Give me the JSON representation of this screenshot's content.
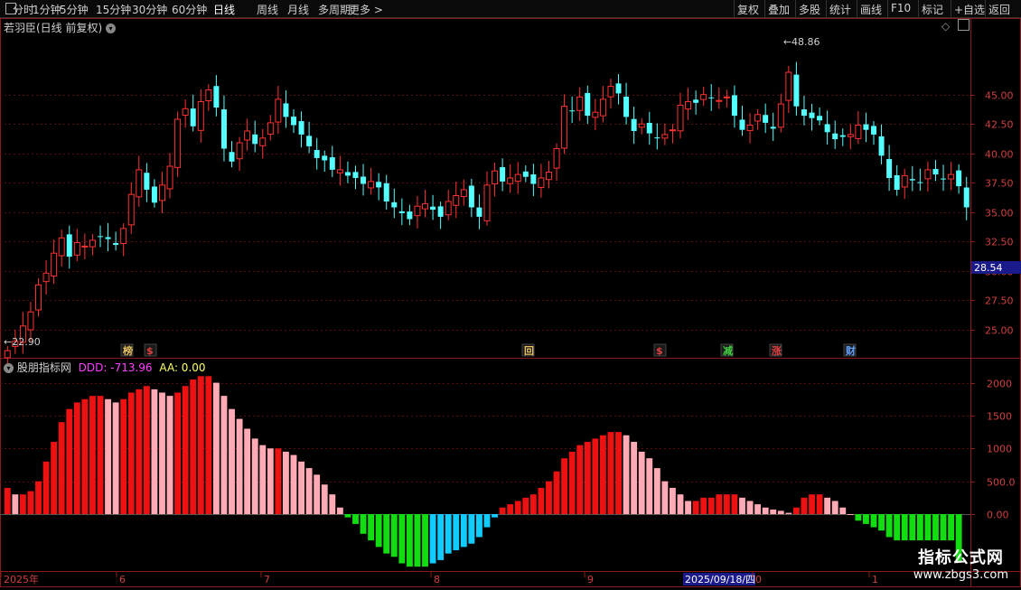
{
  "toolbar": {
    "periods": [
      "分时",
      "1分钟",
      "5分钟",
      "15分钟",
      "30分钟",
      "60分钟",
      "日线",
      "周线",
      "月线",
      "多周期",
      "更多"
    ],
    "active_period": "日线",
    "right_buttons": [
      "复权",
      "叠加",
      "多股",
      "统计",
      "画线",
      "F10",
      "标记",
      "+自选",
      "返回"
    ]
  },
  "main": {
    "title": "若羽臣(日线 前复权)",
    "high_label": "48.86",
    "low_label": "22.90",
    "current_price": "28.54",
    "price_ticks": [
      "45.00",
      "42.50",
      "40.00",
      "37.50",
      "35.00",
      "32.50",
      "30.00",
      "27.50",
      "25.00"
    ],
    "event_badges": [
      {
        "text": "榜",
        "color": "#e8c060"
      },
      {
        "text": "$",
        "color": "#e04040"
      },
      {
        "text": "回",
        "color": "#e8c060"
      },
      {
        "text": "$",
        "color": "#e04040"
      },
      {
        "text": "减",
        "color": "#40d040"
      },
      {
        "text": "涨",
        "color": "#e04040"
      },
      {
        "text": "财",
        "color": "#60a0ff"
      }
    ]
  },
  "indicator": {
    "name": "股朋指标网",
    "ddd_label": "DDD: -713.96",
    "aa_label": "AA: 0.00",
    "ticks": [
      "2000",
      "1500",
      "1000",
      "500.0",
      "0.00"
    ]
  },
  "time_axis": {
    "labels": [
      "2025年",
      "6",
      "7",
      "8",
      "9",
      "2025/09/18/四",
      "0",
      "1"
    ]
  },
  "watermark": {
    "title": "指标公式网",
    "url": "www.zbgs3.com"
  },
  "colors": {
    "up": "#ff3232",
    "down": "#54ffff",
    "macd_red": "#ee1111",
    "macd_pink": "#ffaab4",
    "macd_green": "#11dd11",
    "macd_cyan": "#11ccff",
    "grid": "#5a1010"
  },
  "chart_data": {
    "type": "candlestick",
    "y_range": [
      22.9,
      48.86
    ],
    "closes": [
      23.2,
      24.0,
      25.3,
      26.5,
      28.8,
      29.8,
      31.5,
      32.8,
      31.2,
      32.4,
      32.1,
      32.6,
      32.9,
      32.7,
      32.2,
      33.6,
      36.5,
      38.6,
      36.9,
      35.8,
      37.3,
      38.9,
      42.9,
      43.8,
      42.3,
      44.4,
      45.4,
      43.9,
      40.4,
      39.3,
      40.9,
      41.9,
      40.8,
      41.3,
      42.6,
      44.6,
      43.1,
      42.4,
      41.6,
      40.6,
      39.6,
      39.4,
      38.6,
      38.6,
      38.1,
      37.9,
      37.4,
      37.6,
      37.1,
      35.9,
      35.4,
      34.9,
      34.4,
      35.5,
      35.7,
      35.2,
      34.6,
      35.9,
      36.4,
      36.9,
      35.4,
      34.6,
      37.3,
      38.5,
      37.6,
      37.9,
      38.2,
      38.0,
      37.4,
      37.9,
      38.4,
      40.4,
      44.0,
      43.6,
      44.8,
      43.2,
      43.5,
      44.6,
      45.7,
      45.1,
      43.1,
      41.9,
      42.5,
      41.7,
      41.3,
      41.6,
      42.0,
      44.1,
      44.4,
      44.3,
      45.0,
      44.7,
      44.5,
      44.8,
      43.2,
      42.0,
      42.4,
      43.3,
      42.6,
      42.1,
      44.2,
      46.9,
      44.0,
      43.2,
      43.0,
      42.8,
      41.8,
      41.2,
      41.4,
      41.6,
      42.4,
      42.0,
      41.6,
      39.8,
      37.9,
      36.9,
      38.1,
      37.7,
      37.5,
      38.6,
      38.2,
      37.8,
      38.2,
      37.2,
      35.4
    ],
    "macd": [
      400,
      300,
      300,
      350,
      500,
      800,
      1100,
      1400,
      1600,
      1700,
      1750,
      1800,
      1800,
      1750,
      1700,
      1750,
      1850,
      1900,
      1950,
      1900,
      1850,
      1800,
      1850,
      1950,
      2050,
      2100,
      2100,
      2000,
      1800,
      1600,
      1450,
      1300,
      1150,
      1050,
      1000,
      1000,
      950,
      900,
      800,
      700,
      600,
      450,
      300,
      100,
      -50,
      -150,
      -300,
      -400,
      -500,
      -600,
      -650,
      -750,
      -800,
      -800,
      -800,
      -750,
      -700,
      -600,
      -550,
      -500,
      -450,
      -350,
      -200,
      -50,
      100,
      150,
      200,
      250,
      300,
      400,
      500,
      650,
      850,
      950,
      1050,
      1100,
      1150,
      1200,
      1250,
      1250,
      1200,
      1100,
      950,
      850,
      700,
      500,
      400,
      300,
      200,
      200,
      250,
      250,
      300,
      300,
      300,
      250,
      200,
      150,
      100,
      70,
      50,
      20,
      100,
      250,
      300,
      300,
      250,
      200,
      100,
      0,
      -100,
      -150,
      -200,
      -250,
      -350,
      -400,
      -400,
      -400,
      -400,
      -400,
      -400,
      -400,
      -400,
      -714
    ]
  }
}
